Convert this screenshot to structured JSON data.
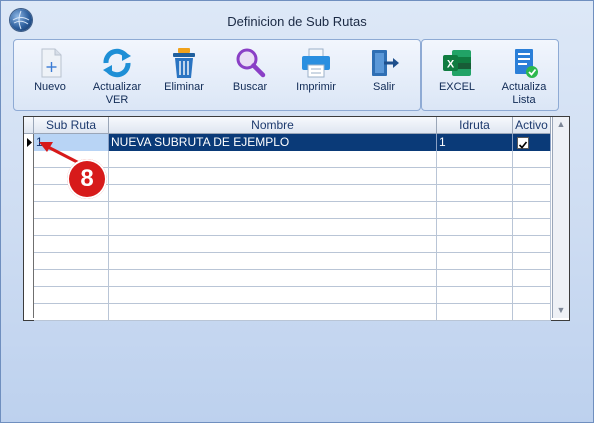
{
  "window": {
    "title": "Definicion de Sub Rutas"
  },
  "toolbar": {
    "nuevo": "Nuevo",
    "actualizar_line1": "Actualizar",
    "actualizar_line2": "VER",
    "eliminar": "Eliminar",
    "buscar": "Buscar",
    "imprimir": "Imprimir",
    "salir": "Salir",
    "excel": "EXCEL",
    "actualiza_line1": "Actualiza",
    "actualiza_line2": "Lista"
  },
  "grid": {
    "columns": [
      "Sub Ruta",
      "Nombre",
      "Idruta",
      "Activo"
    ],
    "rows": [
      {
        "sub_ruta": "1",
        "nombre": "NUEVA SUBRUTA DE EJEMPLO",
        "idruta": "1",
        "activo": true
      }
    ]
  },
  "callout": {
    "number": "8"
  },
  "colors": {
    "selection": "#0a3a78",
    "callout": "#d71a1a"
  }
}
